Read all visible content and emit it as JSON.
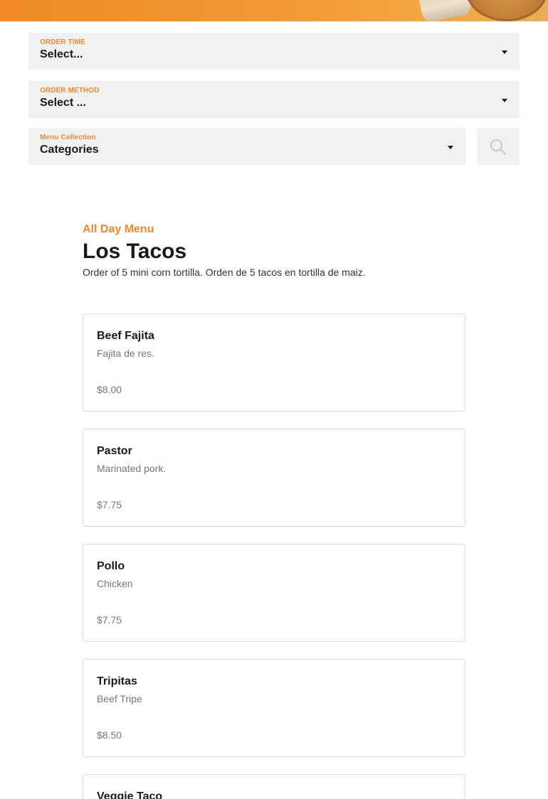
{
  "filters": {
    "order_time": {
      "label": "ORDER TIME",
      "value": "Select..."
    },
    "order_method": {
      "label": "ORDER METHOD",
      "value": "Select ..."
    },
    "menu_collection": {
      "label": "Menu Collection",
      "value": "Categories"
    },
    "search_icon": "search-icon"
  },
  "section": {
    "kicker": "All Day Menu",
    "title": "Los Tacos",
    "description": "Order of 5 mini corn tortilla. Orden de 5 tacos en tortilla de maiz."
  },
  "items": [
    {
      "name": "Beef Fajita",
      "description": "Fajita de res.",
      "price": "$8.00"
    },
    {
      "name": "Pastor",
      "description": "Marinated pork.",
      "price": "$7.75"
    },
    {
      "name": "Pollo",
      "description": "Chicken",
      "price": "$7.75"
    },
    {
      "name": "Tripitas",
      "description": "Beef Tripe",
      "price": "$8.50"
    },
    {
      "name": "Veggie Taco",
      "description": "",
      "price": ""
    }
  ],
  "colors": {
    "accent": "#ef8a2f",
    "field_background": "#f1f1f1",
    "card_border": "#dddddd",
    "muted_text": "#777777"
  }
}
